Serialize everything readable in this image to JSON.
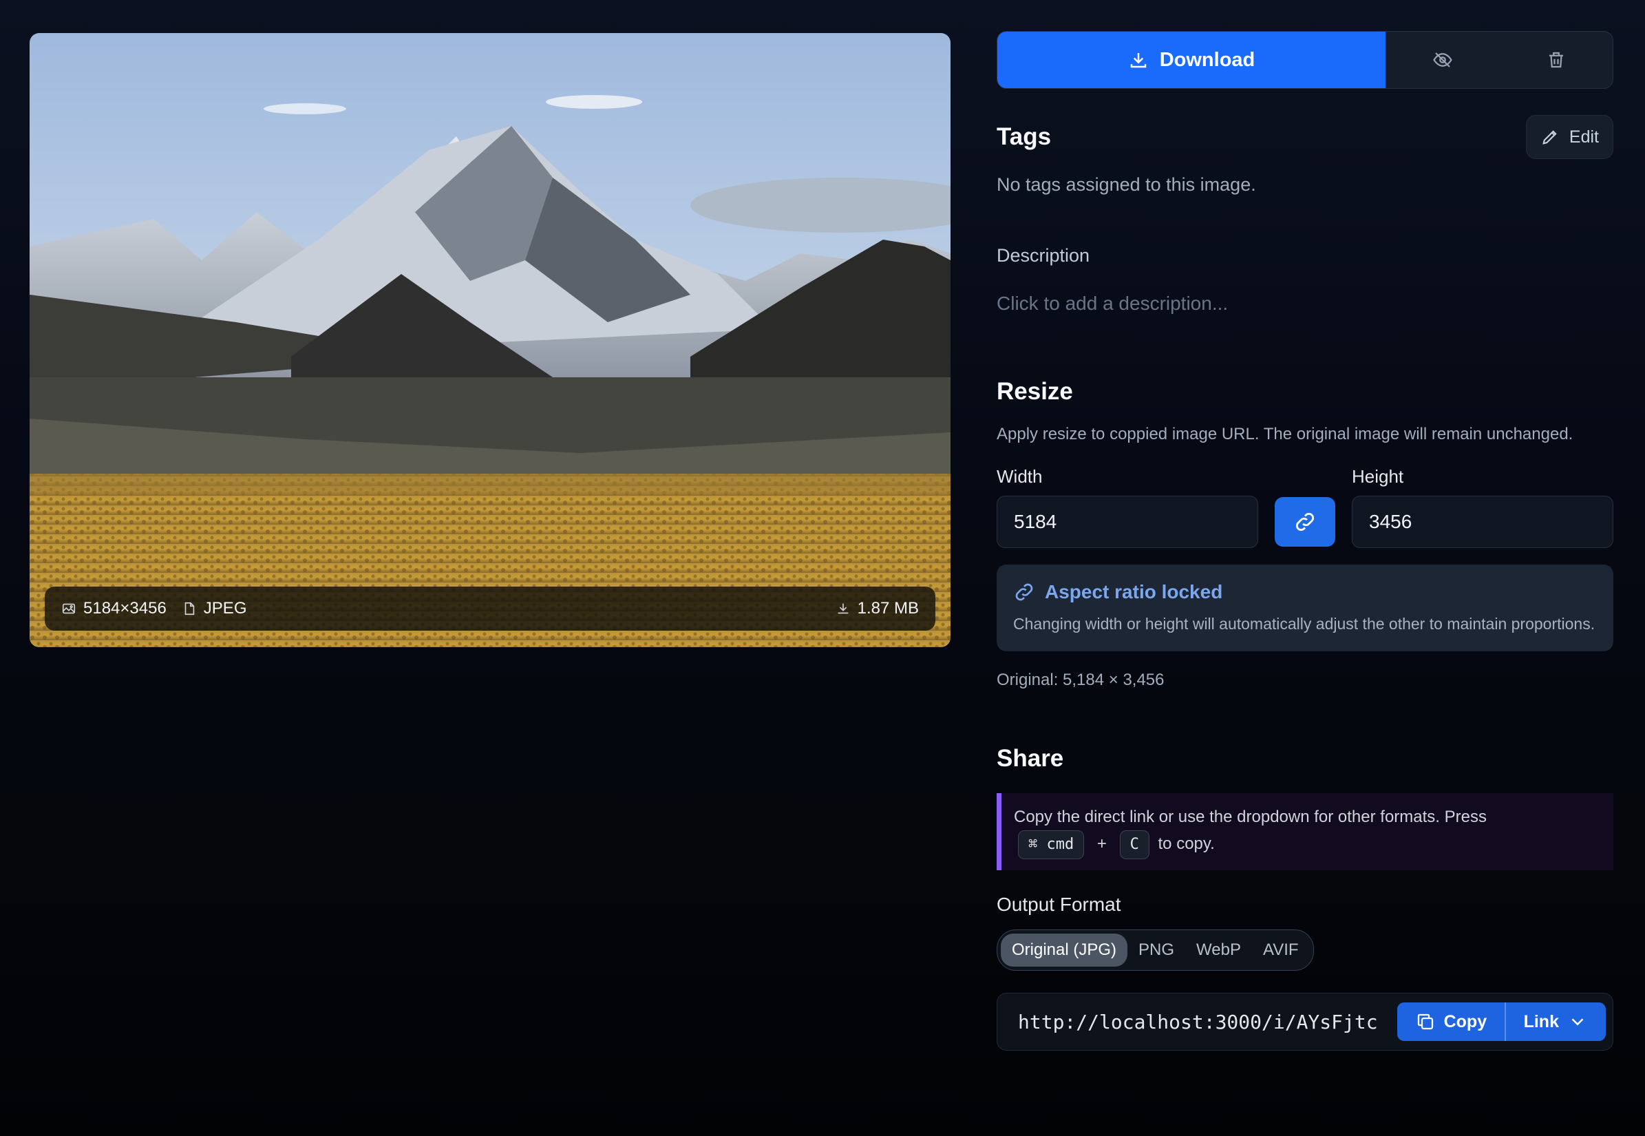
{
  "preview": {
    "dimensions": "5184×3456",
    "format": "JPEG",
    "file_size": "1.87 MB"
  },
  "actions": {
    "download_label": "Download",
    "hide_icon": "eye-off-icon",
    "delete_icon": "trash-icon"
  },
  "tags": {
    "title": "Tags",
    "edit_label": "Edit",
    "empty_text": "No tags assigned to this image."
  },
  "description": {
    "label": "Description",
    "placeholder": "Click to add a description..."
  },
  "resize": {
    "title": "Resize",
    "subtitle": "Apply resize to coppied image URL. The original image will remain unchanged.",
    "width_label": "Width",
    "width_value": "5184",
    "height_label": "Height",
    "height_value": "3456",
    "lock_title": "Aspect ratio locked",
    "lock_text": "Changing width or height will automatically adjust the other to maintain proportions.",
    "original": "Original: 5,184 × 3,456"
  },
  "share": {
    "title": "Share",
    "hint_before": "Copy the direct link or use the dropdown for other formats. Press",
    "key1": "⌘ cmd",
    "plus": "+",
    "key2": "C",
    "hint_after": "to copy.",
    "output_label": "Output Format",
    "formats": [
      "Original (JPG)",
      "PNG",
      "WebP",
      "AVIF"
    ],
    "selected_format": "Original (JPG)",
    "url": "http://localhost:3000/i/AYsFjtc",
    "copy_label": "Copy",
    "link_label": "Link"
  },
  "colors": {
    "accent": "#1a6bfb",
    "share_accent": "#8b5cf6",
    "lock_text": "#7ca7ee"
  }
}
